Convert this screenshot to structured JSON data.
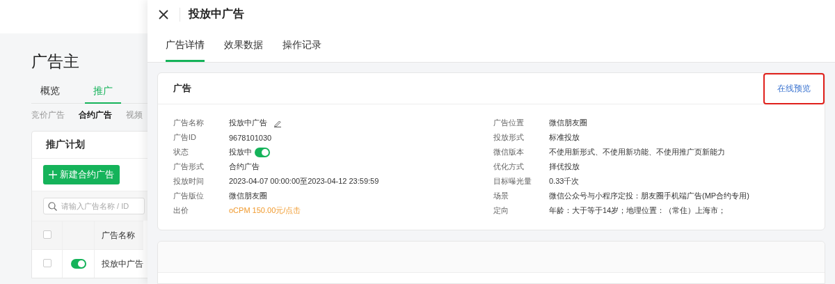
{
  "page": {
    "title": "广告主",
    "tabs": [
      {
        "label": "概览",
        "selected": false
      },
      {
        "label": "推广",
        "selected": true
      }
    ],
    "subtabs": [
      {
        "label": "竞价广告",
        "selected": false
      },
      {
        "label": "合约广告",
        "selected": true
      },
      {
        "label": "视频",
        "selected": false
      }
    ],
    "plan_card": {
      "title": "推广计划",
      "new_button": "新建合约广告",
      "search": {
        "placeholder": "请输入广告名称 / ID"
      },
      "table": {
        "header_checked": false,
        "columns": [
          "广告名称"
        ],
        "rows": [
          {
            "checked": false,
            "on": true,
            "name": "投放中广告"
          }
        ]
      }
    }
  },
  "drawer": {
    "title": "投放中广告",
    "tabs": [
      {
        "label": "广告详情",
        "selected": true
      },
      {
        "label": "效果数据",
        "selected": false
      },
      {
        "label": "操作记录",
        "selected": false
      }
    ],
    "card": {
      "title": "广告",
      "preview_link": {
        "label": "在线预览",
        "highlighted": true
      },
      "left_fields": [
        {
          "label": "广告名称",
          "value": "投放中广告",
          "kind": "editable"
        },
        {
          "label": "广告ID",
          "value": "9678101030",
          "kind": "text"
        },
        {
          "label": "状态",
          "value": "投放中",
          "kind": "toggle",
          "on": true
        },
        {
          "label": "广告形式",
          "value": "合约广告",
          "kind": "text"
        },
        {
          "label": "投放时间",
          "value": "2023-04-07 00:00:00至2023-04-12 23:59:59",
          "kind": "text"
        },
        {
          "label": "广告版位",
          "value": "微信朋友圈",
          "kind": "text"
        },
        {
          "label": "出价",
          "value": "oCPM 150.00元/点击",
          "kind": "price"
        }
      ],
      "right_fields": [
        {
          "label": "广告位置",
          "value": "微信朋友圈",
          "kind": "text"
        },
        {
          "label": "投放形式",
          "value": "标准投放",
          "kind": "text"
        },
        {
          "label": "微信版本",
          "value": "不使用新形式、不使用新功能、不使用推广页新能力",
          "kind": "text"
        },
        {
          "label": "优化方式",
          "value": "择优投放",
          "kind": "text"
        },
        {
          "label": "目标曝光量",
          "value": "0.33千次",
          "kind": "text"
        },
        {
          "label": "场景",
          "value": "微信公众号与小程序定投：朋友圈手机端广告(MP合约专用)",
          "kind": "text"
        },
        {
          "label": "定向",
          "value": "年龄：大于等于14岁；地理位置：（常住）上海市；",
          "kind": "text"
        }
      ]
    }
  }
}
